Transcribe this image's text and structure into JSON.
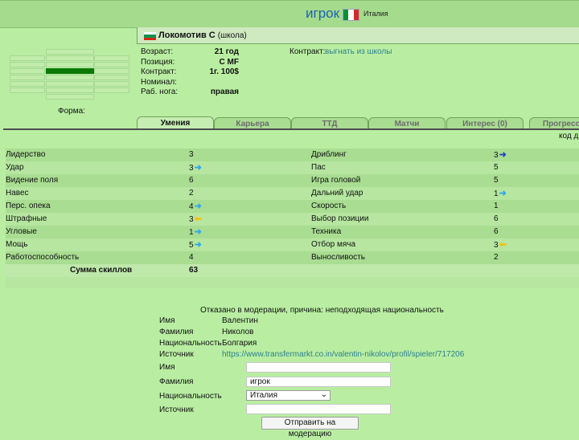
{
  "header": {
    "title": "игрок",
    "country": "Италия"
  },
  "team": {
    "name": "Локомотив С",
    "suffix": "(школа)"
  },
  "form_label": "Форма:",
  "info": [
    {
      "label": "Возраст:",
      "value": "21 год"
    },
    {
      "label": "Позиция:",
      "value": "C MF"
    },
    {
      "label": "Контракт:",
      "value": "1г. 100$"
    },
    {
      "label": "Номинал:",
      "value": ""
    },
    {
      "label": "Раб. нога:",
      "value": "правая"
    }
  ],
  "contract": {
    "label": "Контракт:",
    "link": "выгнать из школы"
  },
  "tabs": [
    "Умения",
    "Карьера",
    "ТТД",
    "Матчи",
    "Интерес (0)",
    "Прогресс"
  ],
  "code_link": "код д",
  "skills": [
    {
      "left": "Лидерство",
      "lv": "3",
      "la": "",
      "right": "Дриблинг",
      "rv": "3",
      "ra": "right-dark"
    },
    {
      "left": "Удар",
      "lv": "3",
      "la": "right",
      "right": "Пас",
      "rv": "5",
      "ra": ""
    },
    {
      "left": "Видение поля",
      "lv": "6",
      "la": "",
      "right": "Игра головой",
      "rv": "5",
      "ra": ""
    },
    {
      "left": "Навес",
      "lv": "2",
      "la": "",
      "right": "Дальний удар",
      "rv": "1",
      "ra": "right"
    },
    {
      "left": "Перс. опека",
      "lv": "4",
      "la": "right",
      "right": "Скорость",
      "rv": "1",
      "ra": ""
    },
    {
      "left": "Штрафные",
      "lv": "3",
      "la": "left",
      "right": "Выбор позиции",
      "rv": "6",
      "ra": ""
    },
    {
      "left": "Угловые",
      "lv": "1",
      "la": "right",
      "right": "Техника",
      "rv": "6",
      "ra": ""
    },
    {
      "left": "Мощь",
      "lv": "5",
      "la": "right",
      "right": "Отбор мяча",
      "rv": "3",
      "ra": "left"
    },
    {
      "left": "Работоспособность",
      "lv": "4",
      "la": "",
      "right": "Выносливость",
      "rv": "2",
      "ra": ""
    }
  ],
  "skills_sum": {
    "label": "Сумма скиллов",
    "value": "63"
  },
  "moderation": {
    "message": "Отказано в модерации, причина: неподходящая национальность",
    "rows": [
      {
        "label": "Имя",
        "value": "Валентин"
      },
      {
        "label": "Фамилия",
        "value": "Николов"
      },
      {
        "label": "Национальность",
        "value": "Болгария"
      },
      {
        "label": "Источник",
        "value": "https://www.transfermarkt.co.in/valentin-nikolov/profil/spieler/717206"
      }
    ]
  },
  "form": {
    "first_name": {
      "label": "Имя",
      "value": ""
    },
    "last_name": {
      "label": "Фамилия",
      "value": "игрок"
    },
    "nationality": {
      "label": "Национальность",
      "value": "Италия"
    },
    "source": {
      "label": "Источник",
      "value": ""
    },
    "submit": "Отправить на модерацию"
  },
  "colors": {
    "arrow_blue": "#2ea9ea",
    "arrow_dark": "#2745c8",
    "arrow_yellow": "#f2c21a",
    "link": "#2f7f8c"
  }
}
